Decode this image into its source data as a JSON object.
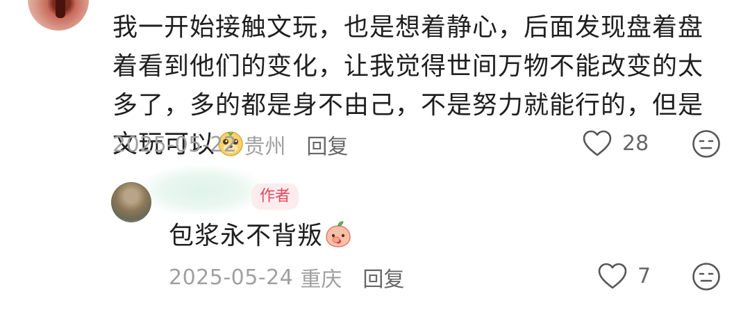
{
  "comment": {
    "text": "我一开始接触文玩，也是想着静心，后面发现盘着盘着看到他们的变化，让我觉得世间万物不能改变的太多了，多的都是身不由己，不是努力就能行的，但是文玩可以",
    "emoji": "doge-emoji",
    "date": "2025-05-22",
    "location": "贵州",
    "reply_label": "回复",
    "likes": "28"
  },
  "reply": {
    "badge": "作者",
    "text": "包浆永不背叛",
    "emoji": "peach-emoji",
    "date": "2025-05-24",
    "location": "重庆",
    "reply_label": "回复",
    "likes": "7"
  },
  "icons": {
    "like": "heart-outline-icon",
    "dislike": "neutral-face-icon"
  },
  "colors": {
    "meta_gray": "#a0a0a0",
    "badge_bg": "#fdecee",
    "badge_text": "#e3495f"
  }
}
